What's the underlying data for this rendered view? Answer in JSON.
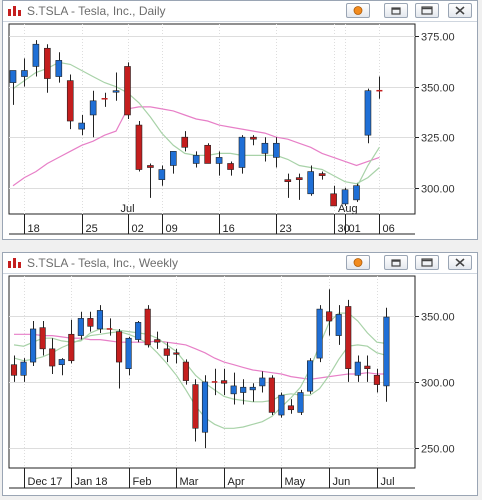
{
  "colors": {
    "up": "#1f6fd6",
    "down": "#c41e1e",
    "neutral": "#c41e1e",
    "ma_short": "#a8d2a8",
    "ma_long": "#e77fc7",
    "grid": "#dddddd",
    "axis": "#222222"
  },
  "windows": [
    {
      "title": "S.TSLA - Tesla, Inc., Daily",
      "buttons": [
        "pin-icon",
        "restore-icon",
        "maximize-icon",
        "close-icon"
      ]
    },
    {
      "title": "S.TSLA - Tesla, Inc., Weekly",
      "buttons": [
        "pin-icon",
        "restore-icon",
        "maximize-icon",
        "close-icon"
      ]
    }
  ],
  "chart_data": [
    {
      "type": "candlestick",
      "title": "S.TSLA - Tesla, Inc., Daily",
      "ylim": [
        287,
        381
      ],
      "y_ticks": [
        300,
        325,
        350,
        375
      ],
      "y_tick_labels": [
        "300.00",
        "325.00",
        "350.00",
        "375.00"
      ],
      "x_ticks": [
        {
          "i": 1,
          "label": "18"
        },
        {
          "i": 6,
          "label": "25"
        },
        {
          "i": 10,
          "label": "02"
        },
        {
          "i": 13,
          "label": "09"
        },
        {
          "i": 18,
          "label": "16"
        },
        {
          "i": 23,
          "label": "23"
        },
        {
          "i": 28,
          "label": "30"
        },
        {
          "i": 29,
          "label": "01"
        },
        {
          "i": 32,
          "label": "06"
        }
      ],
      "period_labels": [
        {
          "i": 10,
          "label": "Jul"
        },
        {
          "i": 29,
          "label": "Aug"
        }
      ],
      "candles": [
        {
          "o": 352,
          "h": 358,
          "l": 341,
          "c": 358,
          "dir": "up"
        },
        {
          "o": 355,
          "h": 364,
          "l": 350,
          "c": 358,
          "dir": "up"
        },
        {
          "o": 360,
          "h": 373,
          "l": 355,
          "c": 371,
          "dir": "up"
        },
        {
          "o": 369,
          "h": 371,
          "l": 347,
          "c": 354,
          "dir": "down"
        },
        {
          "o": 355,
          "h": 367,
          "l": 352,
          "c": 363,
          "dir": "up"
        },
        {
          "o": 353,
          "h": 356,
          "l": 329,
          "c": 333,
          "dir": "down"
        },
        {
          "o": 332,
          "h": 336,
          "l": 326,
          "c": 329,
          "dir": "up"
        },
        {
          "o": 336,
          "h": 348,
          "l": 325,
          "c": 343,
          "dir": "up"
        },
        {
          "o": 344,
          "h": 347,
          "l": 340,
          "c": 344,
          "dir": "neutral"
        },
        {
          "o": 348,
          "h": 357,
          "l": 343,
          "c": 348,
          "dir": "up"
        },
        {
          "o": 360,
          "h": 362,
          "l": 334,
          "c": 336,
          "dir": "down"
        },
        {
          "o": 331,
          "h": 333,
          "l": 308,
          "c": 309,
          "dir": "down"
        },
        {
          "o": 311,
          "h": 312,
          "l": 295,
          "c": 310,
          "dir": "down"
        },
        {
          "o": 304,
          "h": 311,
          "l": 301,
          "c": 309,
          "dir": "up"
        },
        {
          "o": 311,
          "h": 318,
          "l": 307,
          "c": 318,
          "dir": "up"
        },
        {
          "o": 325,
          "h": 328,
          "l": 318,
          "c": 320,
          "dir": "down"
        },
        {
          "o": 312,
          "h": 318,
          "l": 310,
          "c": 316,
          "dir": "up"
        },
        {
          "o": 312,
          "h": 322,
          "l": 312,
          "c": 321,
          "dir": "down"
        },
        {
          "o": 315,
          "h": 318,
          "l": 306,
          "c": 312,
          "dir": "up"
        },
        {
          "o": 312,
          "h": 313,
          "l": 306,
          "c": 309,
          "dir": "down"
        },
        {
          "o": 310,
          "h": 326,
          "l": 307,
          "c": 325,
          "dir": "up"
        },
        {
          "o": 325,
          "h": 326,
          "l": 321,
          "c": 324,
          "dir": "down"
        },
        {
          "o": 317,
          "h": 325,
          "l": 313,
          "c": 322,
          "dir": "up"
        },
        {
          "o": 322,
          "h": 325,
          "l": 310,
          "c": 315,
          "dir": "up"
        },
        {
          "o": 304,
          "h": 307,
          "l": 295,
          "c": 303,
          "dir": "down"
        },
        {
          "o": 305,
          "h": 307,
          "l": 294,
          "c": 304,
          "dir": "down"
        },
        {
          "o": 297,
          "h": 311,
          "l": 296,
          "c": 308,
          "dir": "up"
        },
        {
          "o": 307,
          "h": 308,
          "l": 304,
          "c": 306,
          "dir": "down"
        },
        {
          "o": 297,
          "h": 301,
          "l": 291,
          "c": 291,
          "dir": "down"
        },
        {
          "o": 292,
          "h": 300,
          "l": 291,
          "c": 299,
          "dir": "up"
        },
        {
          "o": 294,
          "h": 302,
          "l": 293,
          "c": 301,
          "dir": "up"
        },
        {
          "o": 326,
          "h": 349,
          "l": 322,
          "c": 348,
          "dir": "up"
        },
        {
          "o": 348,
          "h": 355,
          "l": 344,
          "c": 348,
          "dir": "neutral"
        }
      ],
      "ma_short": [
        349,
        353,
        357,
        359,
        362,
        361,
        358,
        355,
        352,
        350,
        347,
        342,
        335,
        327,
        321,
        317,
        316,
        316,
        317,
        317,
        316,
        316,
        316,
        316,
        314,
        311,
        310,
        309,
        306,
        303,
        302,
        305,
        310
      ],
      "ma_long": [
        301,
        305,
        308,
        312,
        315,
        318,
        321,
        323,
        326,
        328,
        339,
        340,
        340,
        339,
        338,
        336,
        334,
        333,
        331,
        330,
        329,
        328,
        327,
        325,
        324,
        322,
        320,
        317,
        315,
        313,
        311,
        313,
        315
      ],
      "ma_extra": [
        null,
        null,
        null,
        null,
        null,
        null,
        null,
        null,
        null,
        null,
        null,
        null,
        null,
        null,
        null,
        null,
        null,
        null,
        null,
        null,
        null,
        null,
        null,
        null,
        null,
        null,
        null,
        null,
        null,
        null,
        300,
        311,
        320
      ]
    },
    {
      "type": "candlestick",
      "title": "S.TSLA - Tesla, Inc., Weekly",
      "ylim": [
        235,
        380
      ],
      "y_ticks": [
        250,
        300,
        350
      ],
      "y_tick_labels": [
        "250.00",
        "300.00",
        "350.00"
      ],
      "x_ticks": [
        {
          "i": 1,
          "label": "Dec 17"
        },
        {
          "i": 6,
          "label": "Jan 18"
        },
        {
          "i": 12,
          "label": "Feb"
        },
        {
          "i": 17,
          "label": "Mar"
        },
        {
          "i": 22,
          "label": "Apr"
        },
        {
          "i": 28,
          "label": "May"
        },
        {
          "i": 33,
          "label": "Jun"
        },
        {
          "i": 38,
          "label": "Jul"
        }
      ],
      "period_labels": [],
      "candles": [
        {
          "o": 313,
          "h": 320,
          "l": 300,
          "c": 305,
          "dir": "down"
        },
        {
          "o": 305,
          "h": 318,
          "l": 300,
          "c": 315,
          "dir": "up"
        },
        {
          "o": 315,
          "h": 346,
          "l": 312,
          "c": 340,
          "dir": "up"
        },
        {
          "o": 341,
          "h": 346,
          "l": 320,
          "c": 325,
          "dir": "down"
        },
        {
          "o": 325,
          "h": 333,
          "l": 306,
          "c": 312,
          "dir": "down"
        },
        {
          "o": 313,
          "h": 318,
          "l": 305,
          "c": 317,
          "dir": "up"
        },
        {
          "o": 336,
          "h": 347,
          "l": 314,
          "c": 316,
          "dir": "down"
        },
        {
          "o": 335,
          "h": 353,
          "l": 332,
          "c": 348,
          "dir": "up"
        },
        {
          "o": 348,
          "h": 353,
          "l": 338,
          "c": 342,
          "dir": "down"
        },
        {
          "o": 340,
          "h": 358,
          "l": 337,
          "c": 354,
          "dir": "up"
        },
        {
          "o": 340,
          "h": 348,
          "l": 335,
          "c": 340,
          "dir": "neutral"
        },
        {
          "o": 338,
          "h": 340,
          "l": 295,
          "c": 315,
          "dir": "down"
        },
        {
          "o": 310,
          "h": 334,
          "l": 305,
          "c": 333,
          "dir": "up"
        },
        {
          "o": 332,
          "h": 346,
          "l": 330,
          "c": 345,
          "dir": "up"
        },
        {
          "o": 355,
          "h": 358,
          "l": 326,
          "c": 328,
          "dir": "down"
        },
        {
          "o": 330,
          "h": 338,
          "l": 325,
          "c": 332,
          "dir": "down"
        },
        {
          "o": 325,
          "h": 330,
          "l": 315,
          "c": 320,
          "dir": "down"
        },
        {
          "o": 321,
          "h": 325,
          "l": 314,
          "c": 322,
          "dir": "down"
        },
        {
          "o": 315,
          "h": 317,
          "l": 298,
          "c": 301,
          "dir": "down"
        },
        {
          "o": 298,
          "h": 302,
          "l": 255,
          "c": 265,
          "dir": "down"
        },
        {
          "o": 262,
          "h": 305,
          "l": 250,
          "c": 300,
          "dir": "up"
        },
        {
          "o": 300,
          "h": 310,
          "l": 290,
          "c": 300,
          "dir": "neutral"
        },
        {
          "o": 299,
          "h": 310,
          "l": 290,
          "c": 301,
          "dir": "down"
        },
        {
          "o": 291,
          "h": 307,
          "l": 283,
          "c": 297,
          "dir": "up"
        },
        {
          "o": 296,
          "h": 302,
          "l": 283,
          "c": 292,
          "dir": "up"
        },
        {
          "o": 294,
          "h": 299,
          "l": 285,
          "c": 296,
          "dir": "up"
        },
        {
          "o": 297,
          "h": 308,
          "l": 292,
          "c": 303,
          "dir": "up"
        },
        {
          "o": 303,
          "h": 305,
          "l": 275,
          "c": 277,
          "dir": "down"
        },
        {
          "o": 275,
          "h": 292,
          "l": 273,
          "c": 290,
          "dir": "up"
        },
        {
          "o": 282,
          "h": 287,
          "l": 276,
          "c": 279,
          "dir": "down"
        },
        {
          "o": 277,
          "h": 294,
          "l": 275,
          "c": 292,
          "dir": "up"
        },
        {
          "o": 293,
          "h": 318,
          "l": 291,
          "c": 316,
          "dir": "up"
        },
        {
          "o": 318,
          "h": 358,
          "l": 315,
          "c": 355,
          "dir": "up"
        },
        {
          "o": 353,
          "h": 370,
          "l": 335,
          "c": 346,
          "dir": "down"
        },
        {
          "o": 335,
          "h": 358,
          "l": 328,
          "c": 351,
          "dir": "up"
        },
        {
          "o": 357,
          "h": 362,
          "l": 300,
          "c": 310,
          "dir": "down"
        },
        {
          "o": 305,
          "h": 320,
          "l": 300,
          "c": 315,
          "dir": "up"
        },
        {
          "o": 310,
          "h": 320,
          "l": 300,
          "c": 312,
          "dir": "down"
        },
        {
          "o": 305,
          "h": 310,
          "l": 292,
          "c": 298,
          "dir": "down"
        },
        {
          "o": 297,
          "h": 356,
          "l": 285,
          "c": 349,
          "dir": "up"
        }
      ],
      "ma_short": [
        328,
        327,
        330,
        333,
        333,
        331,
        330,
        331,
        337,
        340,
        340,
        339,
        338,
        337,
        336,
        333,
        328,
        323,
        314,
        305,
        299,
        294,
        289,
        287,
        286,
        285,
        285,
        286,
        290,
        291,
        290,
        290,
        295,
        305,
        317,
        327,
        328,
        327,
        322,
        320
      ],
      "ma_long": [
        336,
        336,
        336,
        335,
        335,
        334,
        333,
        333,
        332,
        332,
        331,
        330,
        330,
        330,
        330,
        331,
        330,
        329,
        328,
        325,
        322,
        318,
        315,
        313,
        311,
        309,
        308,
        307,
        306,
        304,
        303,
        302,
        303,
        304,
        305,
        306,
        306,
        307,
        306,
        306
      ],
      "ma_extra": [
        318,
        316,
        317,
        319,
        322,
        326,
        329,
        332,
        335,
        336,
        337,
        338,
        336,
        333,
        329,
        322,
        314,
        305,
        294,
        282,
        273,
        268,
        265,
        265,
        266,
        268,
        270,
        274,
        281,
        288,
        296,
        310,
        328,
        345,
        352,
        352,
        346,
        337,
        330,
        329
      ]
    }
  ]
}
